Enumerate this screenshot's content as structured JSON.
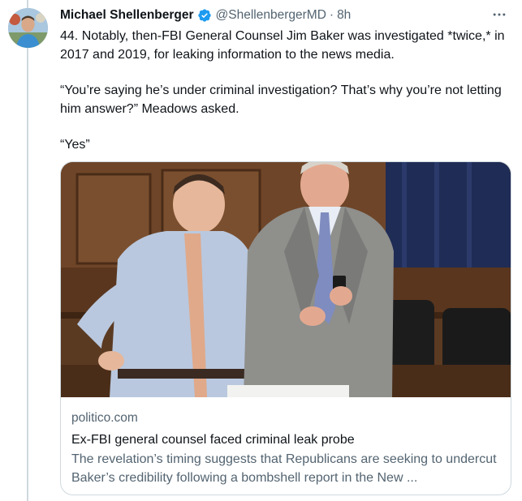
{
  "tweet": {
    "author_name": "Michael Shellenberger",
    "handle": "@ShellenbergerMD",
    "separator": "·",
    "time": "8h",
    "more_icon": "more-dots-icon",
    "verified_icon": "verified-badge-icon",
    "paragraphs": [
      "44. Notably, then-FBI General Counsel Jim Baker was investigated *twice,* in 2017 and 2019, for leaking information to the news media.",
      "“You’re saying he’s under criminal investigation? That’s why you’re not letting him answer?” Meadows asked.",
      "“Yes”"
    ]
  },
  "card": {
    "domain": "politico.com",
    "title": "Ex-FBI general counsel faced criminal leak probe",
    "description": "The revelation’s timing suggests that Republicans are seeking to undercut Baker’s credibility following a bombshell report in the New ..."
  },
  "colors": {
    "verified": "#1d9bf0",
    "border": "#cfd9de",
    "secondary_text": "#536471",
    "primary_text": "#0f1419"
  }
}
